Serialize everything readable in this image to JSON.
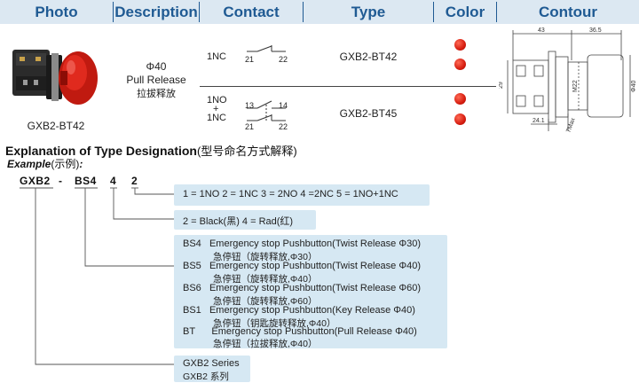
{
  "header": {
    "photo": "Photo",
    "description": "Description",
    "contact": "Contact",
    "type": "Type",
    "color": "Color",
    "contour": "Contour"
  },
  "product": {
    "photo_caption": "GXB2-BT42",
    "diameter": "Φ40",
    "release_en": "Pull Release",
    "release_cn": "拉拔释放",
    "rows": [
      {
        "contact_label": "1NC",
        "terminals": [
          "21",
          "22"
        ],
        "type": "GXB2-BT42",
        "colors": [
          "#d61d10",
          "#d61d10"
        ]
      },
      {
        "contact_label_top": "1NO",
        "contact_plus": "+",
        "contact_label_bottom": "1NC",
        "terminals_top": [
          "13",
          "14"
        ],
        "terminals_bottom": [
          "21",
          "22"
        ],
        "type": "GXB2-BT45",
        "colors": [
          "#d61d10",
          "#d61d10"
        ]
      }
    ]
  },
  "contour": {
    "dim_top_left": "43",
    "dim_top_right": "36.5",
    "dim_height": "29",
    "dim_m22": "M22",
    "dim_phi": "Φ40",
    "dim_bottom": "24.1",
    "dim_max": "7Max"
  },
  "explanation": {
    "title": "Explanation of Type Designation",
    "title_cn": "(型号命名方式解释)",
    "example": "Example",
    "example_cn": "(示例)",
    "example_colon": ":",
    "code": {
      "series": "GXB2",
      "dash1": "-",
      "op": "BS4",
      "color": "4",
      "contact": "2"
    },
    "contact_box": "1 = 1NO   2 = 1NC   3 = 2NO 4 =2NC 5 = 1NO+1NC",
    "color_box": "2 = Black(黑)   4 = Rad(红)",
    "operator_box": [
      {
        "code": "BS4",
        "en": "Emergency stop Pushbutton(Twist Release Φ30)",
        "cn": "急停钮（旋转释放,Φ30）"
      },
      {
        "code": "BS5",
        "en": "Emergency stop Pushbutton(Twist Release Φ40)",
        "cn": "急停钮（旋转释放,Φ40）"
      },
      {
        "code": "BS6",
        "en": "Emergency stop Pushbutton(Twist Release Φ60)",
        "cn": "急停钮（旋转释放,Φ60）"
      },
      {
        "code": "BS1",
        "en": "Emergency stop Pushbutton(Key Release    Φ40)",
        "cn": "急停钮（钥匙旋转释放,Φ40）"
      },
      {
        "code": "BT",
        "en": "Emergency stop Pushbutton(Pull Release    Φ40)",
        "cn": "急停钮（拉拔释放,Φ40）"
      }
    ],
    "series_box": {
      "en": "GXB2 Series",
      "cn": "GXB2 系列"
    }
  }
}
